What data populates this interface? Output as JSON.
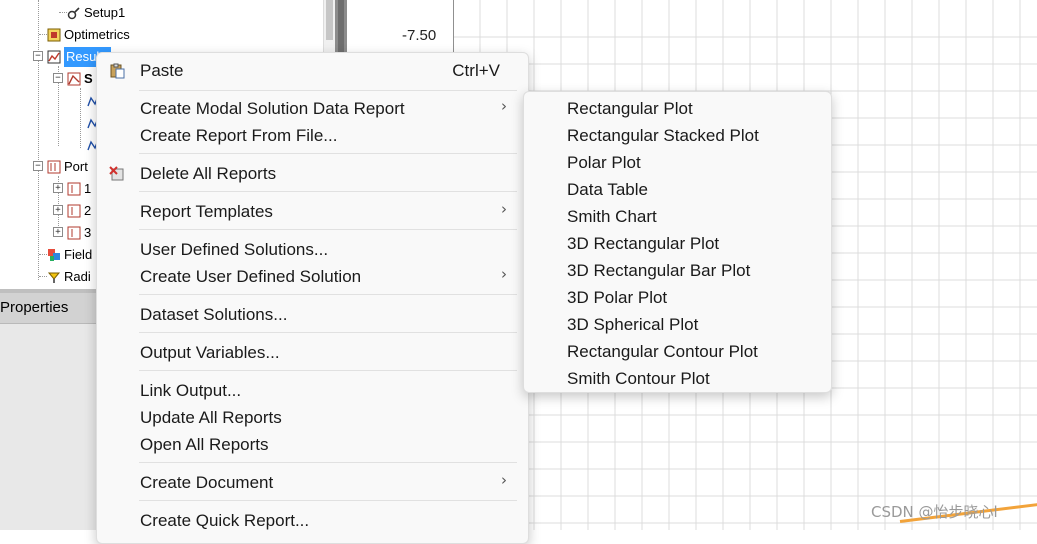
{
  "tree": {
    "items": [
      {
        "label": "Setup1"
      },
      {
        "label": "Optimetrics"
      },
      {
        "label": "Results"
      },
      {
        "label": "S"
      },
      {
        "label": ""
      },
      {
        "label": ""
      },
      {
        "label": ""
      },
      {
        "label": "Port"
      },
      {
        "label": "1"
      },
      {
        "label": "2"
      },
      {
        "label": "3"
      },
      {
        "label": "Field"
      },
      {
        "label": "Radi"
      }
    ]
  },
  "properties": {
    "title": "Properties"
  },
  "plot": {
    "y_tick_label": "-7.50"
  },
  "context_menu": {
    "items": [
      {
        "label": "Paste",
        "accel": "Ctrl+V",
        "icon": "paste-icon"
      },
      {
        "label": "Create Modal Solution Data Report",
        "submenu": true
      },
      {
        "label": "Create Report From File..."
      },
      {
        "label": "Delete All Reports",
        "icon": "delete-reports-icon"
      },
      {
        "label": "Report Templates",
        "submenu": true
      },
      {
        "label": "User Defined Solutions..."
      },
      {
        "label": "Create User Defined Solution",
        "submenu": true
      },
      {
        "label": "Dataset Solutions..."
      },
      {
        "label": "Output Variables..."
      },
      {
        "label": "Link Output..."
      },
      {
        "label": "Update All Reports"
      },
      {
        "label": "Open All Reports"
      },
      {
        "label": "Create Document",
        "submenu": true
      },
      {
        "label": "Create Quick Report..."
      }
    ],
    "submenu_arrow": "›"
  },
  "submenu": {
    "items": [
      {
        "label": "Rectangular Plot"
      },
      {
        "label": "Rectangular Stacked Plot"
      },
      {
        "label": "Polar Plot"
      },
      {
        "label": "Data Table"
      },
      {
        "label": "Smith Chart"
      },
      {
        "label": "3D Rectangular Plot"
      },
      {
        "label": "3D Rectangular Bar Plot"
      },
      {
        "label": "3D Polar Plot"
      },
      {
        "label": "3D Spherical Plot"
      },
      {
        "label": "Rectangular Contour Plot"
      },
      {
        "label": "Smith Contour Plot"
      }
    ]
  },
  "watermark": {
    "text": "CSDN @怡步晓心l"
  },
  "colors": {
    "selection": "#3399ff",
    "menu_bg": "#f9f9f9",
    "accent": "#f2a33a"
  }
}
